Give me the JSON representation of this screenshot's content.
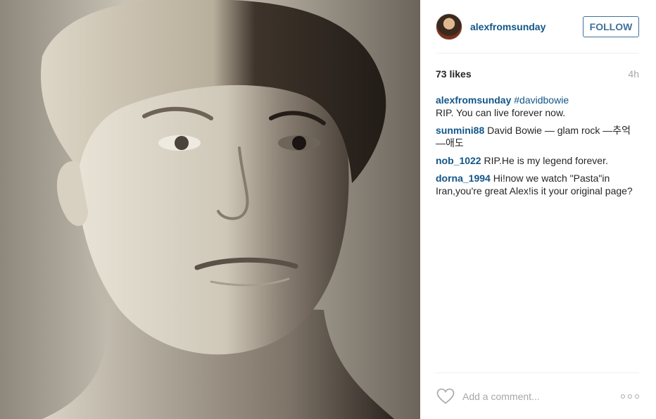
{
  "post": {
    "photo": {
      "alt_subject": "black-and-white portrait photo",
      "icon": "portrait-photo"
    },
    "author": {
      "username": "alexfromsunday"
    },
    "follow_label": "FOLLOW",
    "likes": "73 likes",
    "age": "4h",
    "comments": [
      {
        "user": "alexfromsunday",
        "hashtag": "#davidbowie",
        "text": "RIP. You can live forever now."
      },
      {
        "user": "sunmini88",
        "text": "David Bowie — glam rock —추억—애도"
      },
      {
        "user": "nob_1022",
        "text": "RIP.He is my legend forever."
      },
      {
        "user": "dorna_1994",
        "text": "Hi!now we watch \"Pasta\"in Iran,you're great Alex!is it your original page?"
      }
    ],
    "add_comment_placeholder": "Add a comment...",
    "icons": {
      "like": "heart-icon",
      "more": "more-options-icon"
    },
    "colors": {
      "link": "#125688",
      "follow": "#3f729b",
      "muted": "#a5a7aa"
    }
  }
}
